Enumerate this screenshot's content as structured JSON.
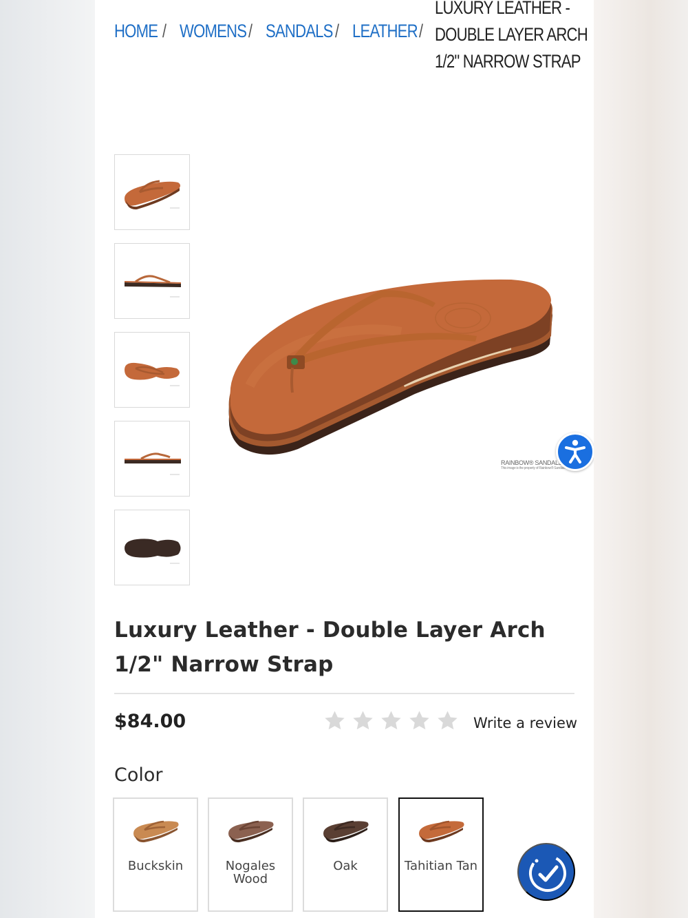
{
  "breadcrumb": {
    "items": [
      "HOME",
      "WOMENS",
      "SANDALS",
      "LEATHER"
    ],
    "separator": "/",
    "current": "LUXURY LEATHER - DOUBLE LAYER ARCH 1/2\" NARROW STRAP"
  },
  "gallery": {
    "thumbnails": [
      "sandal-angle-view",
      "sandal-side-view",
      "sandal-top-view",
      "sandal-side-view-right",
      "sandal-sole-view"
    ],
    "watermark": "RAINBOW® SANDALS, INC.",
    "watermark_note": "This image is the property of Rainbow® Sandals"
  },
  "product": {
    "title": "Luxury Leather - Double Layer Arch 1/2\" Narrow Strap",
    "price": "$84.00",
    "rating": 0,
    "rating_max": 5,
    "review_link": "Write a review"
  },
  "colors": {
    "label": "Color",
    "options": [
      {
        "name": "Buckskin",
        "strap": "#b9723f",
        "sole": "#8a5530"
      },
      {
        "name": "Nogales Wood",
        "strap": "#7d5340",
        "sole": "#4a2f22"
      },
      {
        "name": "Oak",
        "strap": "#5a3f33",
        "sole": "#2e201a"
      },
      {
        "name": "Tahitian Tan",
        "strap": "#c46a3a",
        "sole": "#6e3a20"
      }
    ],
    "selected": "Tahitian Tan"
  },
  "theme": {
    "link_color": "#1f6fc6",
    "leather": "#c4693a",
    "accessibility_blue": "#1a6fe0",
    "chat_blue": "#1b58b5"
  }
}
